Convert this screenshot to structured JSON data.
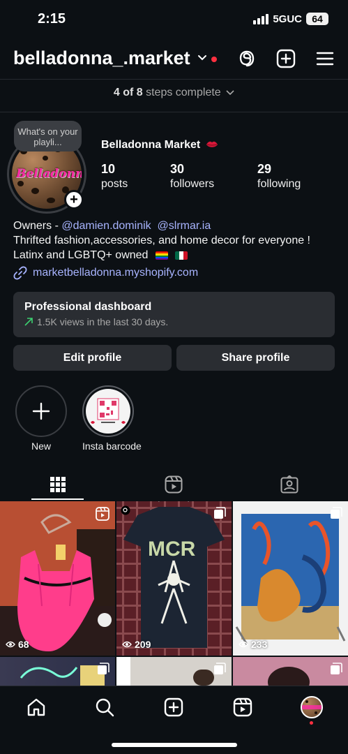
{
  "status_bar": {
    "time": "2:15",
    "network": "5GUC",
    "battery": "64"
  },
  "header": {
    "username": "belladonna_.market"
  },
  "steps": {
    "progress": "4 of 8",
    "suffix": "steps complete"
  },
  "note": {
    "text": "What's on your playli..."
  },
  "profile": {
    "avatar_text": "Belladonna",
    "display_name": "Belladonna Market",
    "stats": [
      {
        "num": "10",
        "label": "posts"
      },
      {
        "num": "30",
        "label": "followers"
      },
      {
        "num": "29",
        "label": "following"
      }
    ],
    "bio_prefix": "Owners - ",
    "mention_1": "@damien.dominik",
    "mention_2": "@slrmar.ia",
    "bio_line_2": "Thrifted fashion,accessories, and home decor for everyone !",
    "bio_line_3": "Latinx and LGBTQ+ owned",
    "link": "marketbelladonna.myshopify.com"
  },
  "dashboard": {
    "title": "Professional dashboard",
    "subtitle": "1.5K views in the last 30 days."
  },
  "buttons": {
    "edit": "Edit profile",
    "share": "Share profile"
  },
  "highlights": [
    {
      "label": "New"
    },
    {
      "label": "Insta barcode"
    }
  ],
  "tabs": {
    "active": "grid"
  },
  "posts": [
    {
      "views": "68",
      "type": "reel"
    },
    {
      "views": "209",
      "type": "carousel"
    },
    {
      "views": "233",
      "type": "carousel"
    }
  ],
  "colors": {
    "background": "#0c1014",
    "link": "#a8b4ff",
    "card": "#2a2d32",
    "notification": "#ff3040"
  }
}
